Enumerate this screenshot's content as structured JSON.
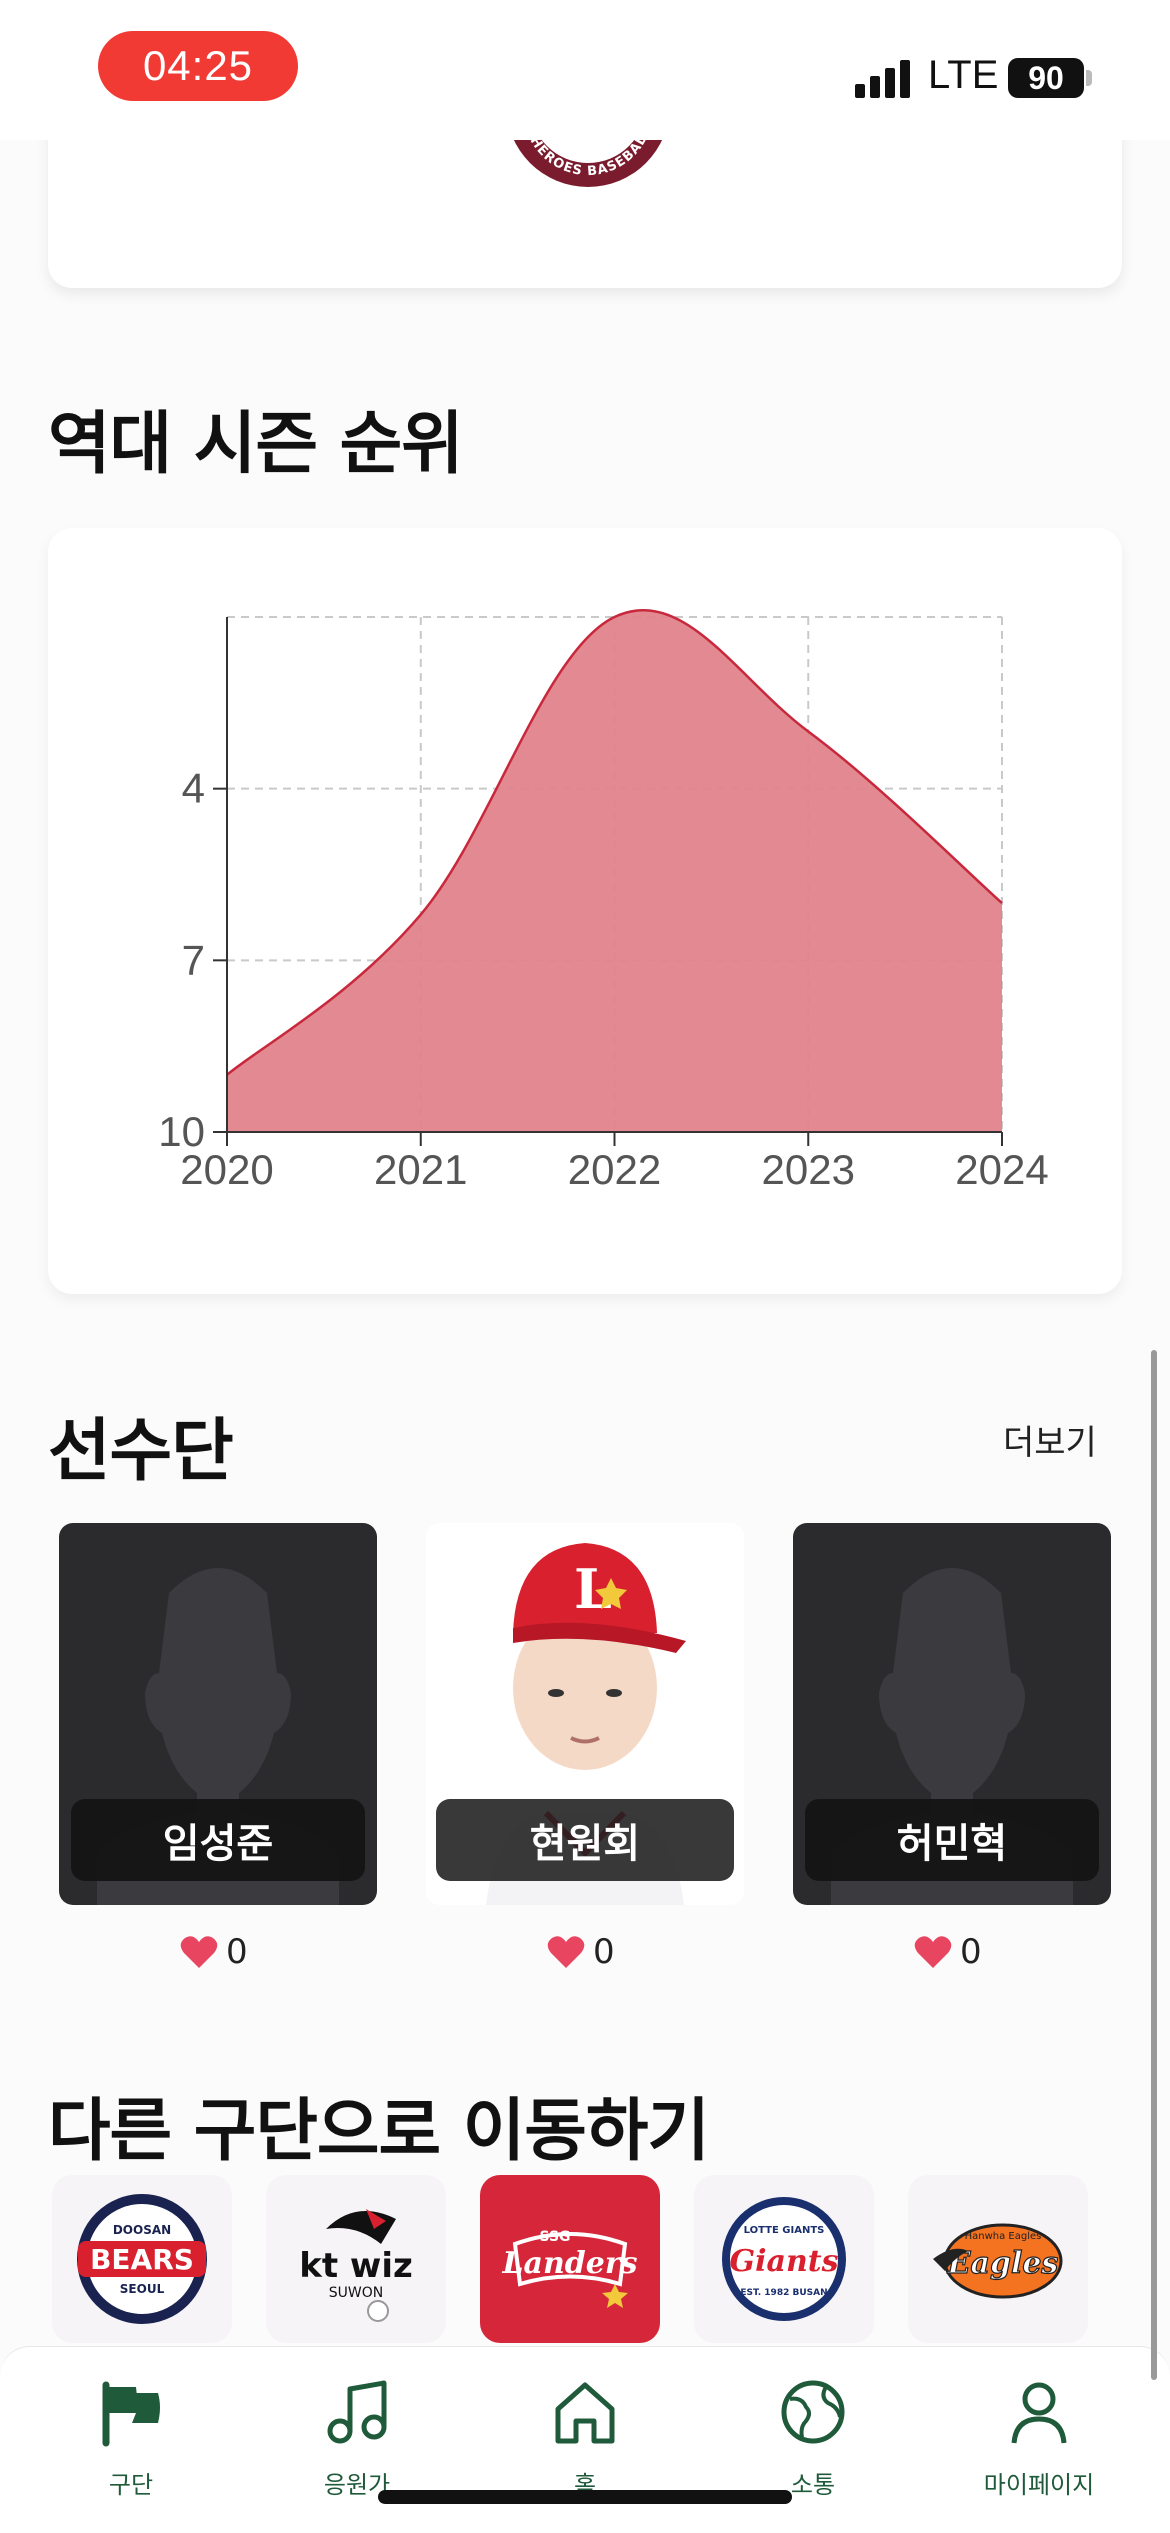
{
  "status_bar": {
    "time": "04:25",
    "network": "LTE",
    "battery": "90"
  },
  "team_emblem": {
    "text": "SEOUL HEROES BASEBALL CLUB",
    "color": "#7a1b2e"
  },
  "season_rank": {
    "title": "역대 시즌 순위"
  },
  "chart_data": {
    "type": "area",
    "title": "",
    "x": [
      2020,
      2021,
      2022,
      2023,
      2024
    ],
    "y_ticks": [
      4,
      7,
      10
    ],
    "series": [
      {
        "values": [
          9,
          6.2,
          1,
          3,
          6
        ]
      }
    ],
    "ylim": [
      1,
      10
    ],
    "y_inverted": true,
    "grid": true,
    "fill_color": "#e2838c",
    "line_color": "#c8283c"
  },
  "roster": {
    "title": "선수단",
    "more_label": "더보기",
    "players": [
      {
        "name": "임성준",
        "likes": "0",
        "has_photo": false
      },
      {
        "name": "현원회",
        "likes": "0",
        "has_photo": true
      },
      {
        "name": "허민혁",
        "likes": "0",
        "has_photo": false
      }
    ]
  },
  "other_teams": {
    "title": "다른 구단으로 이동하기",
    "teams": [
      {
        "name": "BEARS",
        "sub": "DOOSAN",
        "city": "SEOUL",
        "selected": false
      },
      {
        "name": "kt wiz",
        "sub": "",
        "city": "SUWON",
        "selected": false
      },
      {
        "name": "Landers",
        "sub": "SSG",
        "city": "",
        "selected": true
      },
      {
        "name": "Giants",
        "sub": "LOTTE GIANTS",
        "city": "EST. 1982 BUSAN",
        "selected": false
      },
      {
        "name": "Eagles",
        "sub": "Hanwha Eagles",
        "city": "",
        "selected": false
      }
    ]
  },
  "tab_bar": {
    "tabs": [
      {
        "label": "구단",
        "icon": "team-flag-icon"
      },
      {
        "label": "응원가",
        "icon": "music-note-icon"
      },
      {
        "label": "홈",
        "icon": "home-icon"
      },
      {
        "label": "소통",
        "icon": "globe-icon"
      },
      {
        "label": "마이페이지",
        "icon": "profile-icon"
      }
    ]
  }
}
